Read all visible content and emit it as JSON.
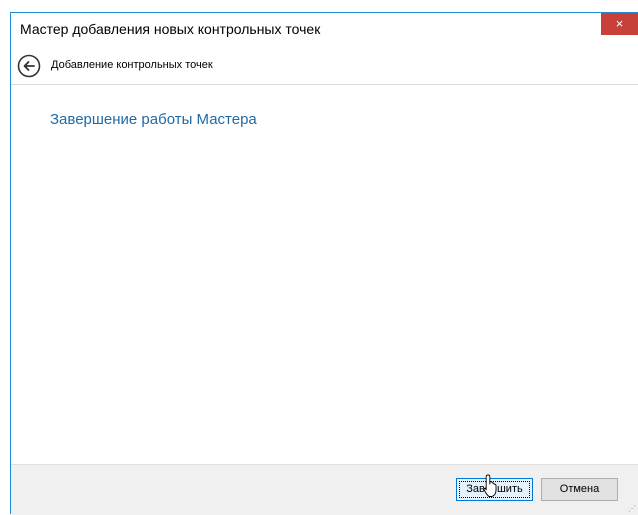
{
  "window": {
    "title": "Мастер добавления новых контрольных точек",
    "close_label": "×"
  },
  "nav": {
    "title": "Добавление контрольных точек",
    "back_icon": "back-arrow-icon"
  },
  "main": {
    "heading": "Завершение работы Мастера"
  },
  "footer": {
    "finish_label": "Завершить",
    "cancel_label": "Отмена"
  },
  "colors": {
    "accent": "#1f6aa6",
    "close": "#c7413a",
    "border": "#1e8bd6"
  }
}
